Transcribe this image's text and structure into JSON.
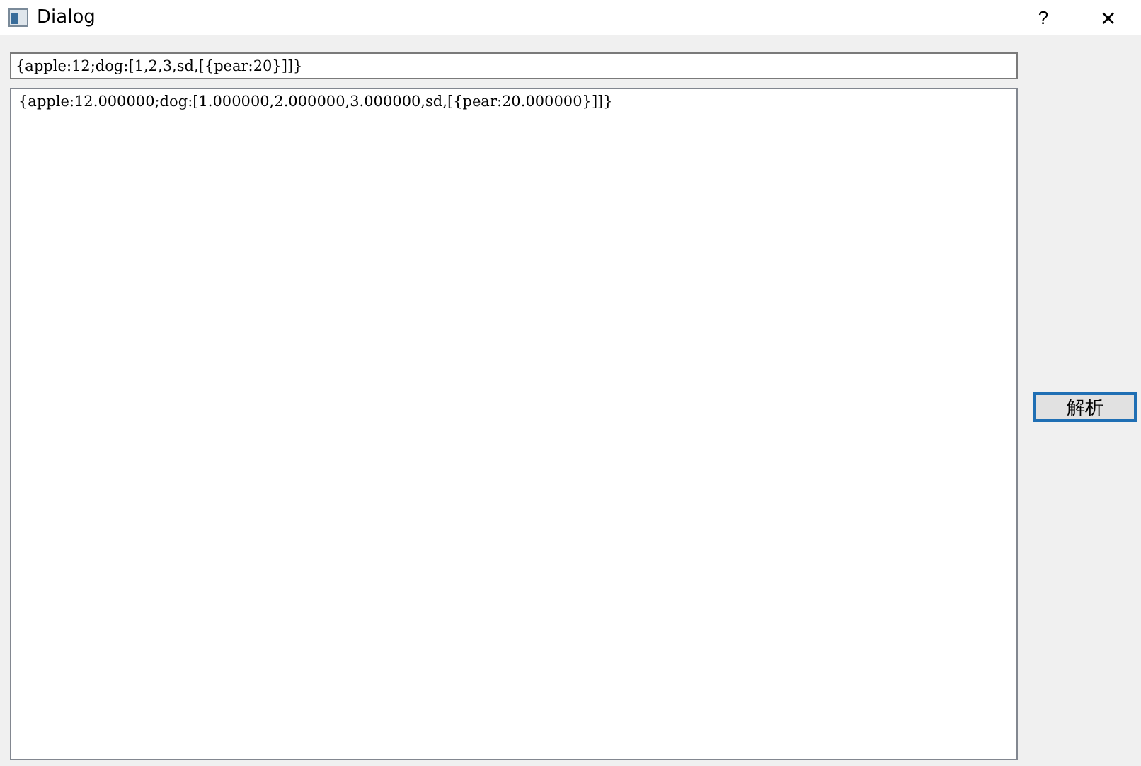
{
  "window": {
    "title": "Dialog",
    "help": "?",
    "close": "✕"
  },
  "input": {
    "value": "{apple:12;dog:[1,2,3,sd,[{pear:20}]]}"
  },
  "output": {
    "value": "{apple:12.000000;dog:[1.000000,2.000000,3.000000,sd,[{pear:20.000000}]]}"
  },
  "button": {
    "label": "解析"
  }
}
